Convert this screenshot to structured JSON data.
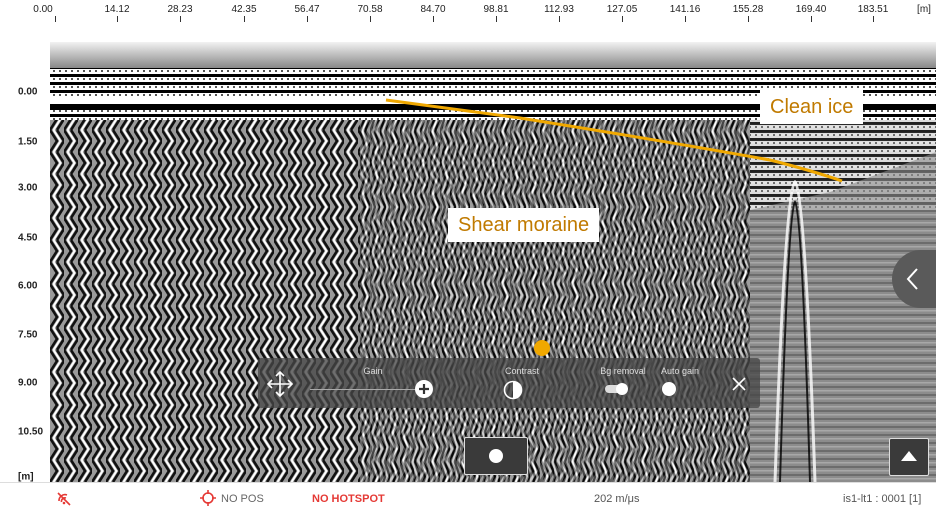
{
  "distance_axis": {
    "ticks": [
      "0.00",
      "14.12",
      "28.23",
      "42.35",
      "56.47",
      "70.58",
      "84.70",
      "98.81",
      "112.93",
      "127.05",
      "141.16",
      "155.28",
      "169.40",
      "183.51"
    ],
    "unit": "[m]"
  },
  "depth_axis": {
    "ticks": [
      "0.00",
      "1.50",
      "3.00",
      "4.50",
      "6.00",
      "7.50",
      "9.00",
      "10.50"
    ],
    "unit": "[m]"
  },
  "annotations": {
    "clean_ice": "Clean ice",
    "shear_moraine": "Shear moraine",
    "line_color": "#f0a800"
  },
  "toolbar": {
    "gain_label": "Gain",
    "contrast_label": "Contrast",
    "bg_removal_label": "Bg removal",
    "auto_gain_label": "Auto gain"
  },
  "status_bar": {
    "no_pos": "NO POS",
    "no_hotspot": "NO HOTSPOT",
    "velocity": "202  m/μs",
    "file_info": "is1-lt1 : 0001 [1]",
    "alert_color": "#e53935"
  }
}
